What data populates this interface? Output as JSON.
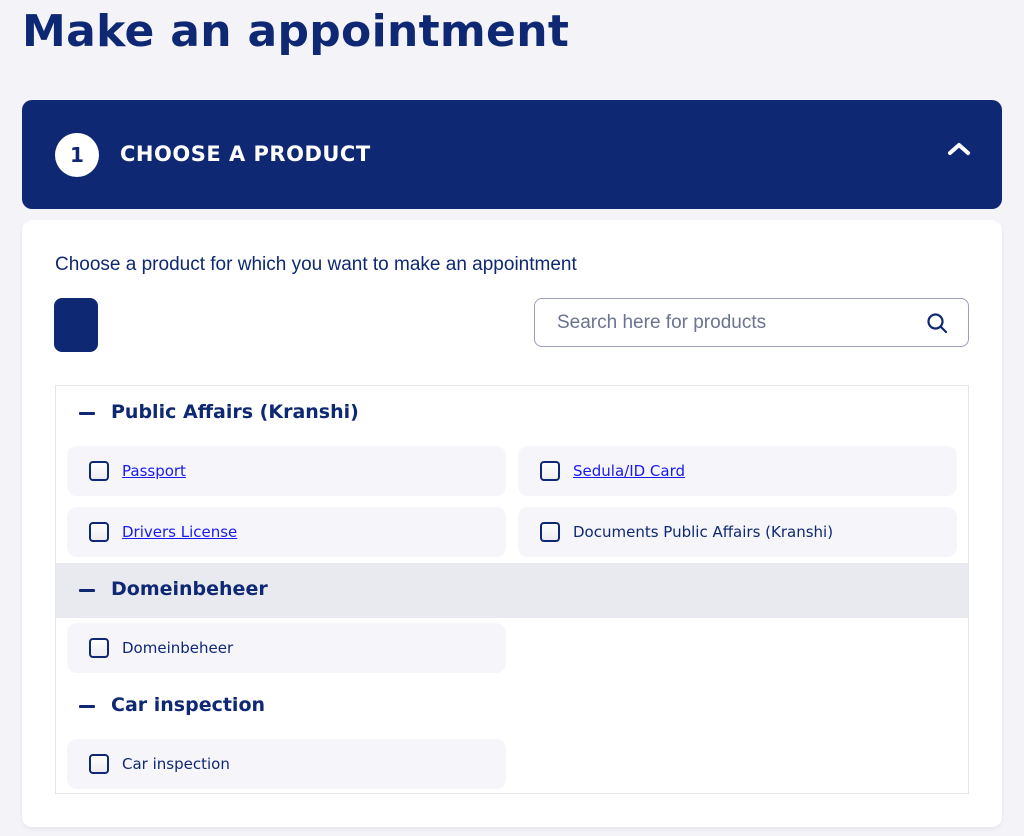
{
  "page": {
    "title": "Make an appointment"
  },
  "step": {
    "number": "1",
    "title": "CHOOSE A PRODUCT",
    "toggle_icon": "chevron-up-icon"
  },
  "panel": {
    "intro": "Choose a product for which you want to make an appointment",
    "search": {
      "placeholder": "Search here for products",
      "value": "",
      "icon": "search-icon"
    }
  },
  "groups": [
    {
      "title": "Public Affairs (Kranshi)",
      "expanded": true,
      "items": [
        {
          "label": "Passport",
          "link": true,
          "checked": false
        },
        {
          "label": "Sedula/ID Card",
          "link": true,
          "checked": false
        },
        {
          "label": "Drivers License",
          "link": true,
          "checked": false
        },
        {
          "label": "Documents Public Affairs (Kranshi)",
          "link": false,
          "checked": false
        }
      ]
    },
    {
      "title": "Domeinbeheer",
      "expanded": true,
      "hovered": true,
      "items": [
        {
          "label": "Domeinbeheer",
          "link": false,
          "checked": false
        }
      ]
    },
    {
      "title": "Car inspection",
      "expanded": true,
      "items": [
        {
          "label": "Car inspection",
          "link": false,
          "checked": false
        }
      ]
    }
  ],
  "colors": {
    "brand": "#0f2873",
    "link": "#1a1aee",
    "background": "#f3f3f8",
    "item_background": "#f5f5fa",
    "hover_background": "#e9eaf0"
  }
}
